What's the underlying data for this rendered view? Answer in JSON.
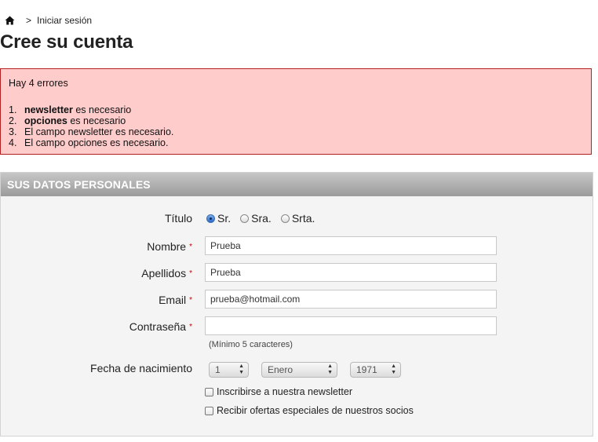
{
  "breadcrumb": {
    "separator": ">",
    "current": "Iniciar sesión"
  },
  "page_title": "Cree su cuenta",
  "errors": {
    "title": "Hay 4 errores",
    "items": [
      {
        "num": "1.",
        "strong": "newsletter",
        "text": " es necesario"
      },
      {
        "num": "2.",
        "strong": "opciones",
        "text": " es necesario"
      },
      {
        "num": "3.",
        "strong": "",
        "text": "El campo newsletter es necesario."
      },
      {
        "num": "4.",
        "strong": "",
        "text": "El campo opciones es necesario."
      }
    ]
  },
  "section": {
    "legend": "SUS DATOS PERSONALES",
    "title_label": "Título",
    "title_options": [
      {
        "label": "Sr.",
        "checked": true
      },
      {
        "label": "Sra.",
        "checked": false
      },
      {
        "label": "Srta.",
        "checked": false
      }
    ],
    "required_mark": "*",
    "nombre": {
      "label": "Nombre",
      "value": "Prueba"
    },
    "apellidos": {
      "label": "Apellidos",
      "value": "Prueba"
    },
    "email": {
      "label": "Email",
      "value": "prueba@hotmail.com"
    },
    "password": {
      "label": "Contraseña",
      "value": "",
      "hint": "(Mínimo 5 caracteres)"
    },
    "birthdate": {
      "label": "Fecha de nacimiento",
      "day": "1",
      "month": "Enero",
      "year": "1971"
    },
    "newsletter_label": "Inscribirse a nuestra newsletter",
    "offers_label": "Recibir ofertas especiales de nuestros socios"
  }
}
